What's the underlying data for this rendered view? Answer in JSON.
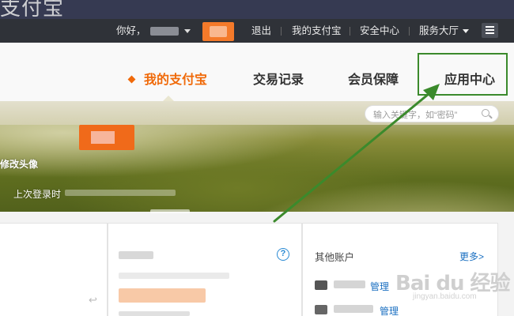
{
  "header": {
    "brand_fragment": "支付宝",
    "greeting": "你好，",
    "logout": "退出",
    "my_alipay": "我的支付宝",
    "security": "安全中心",
    "service_hall": "服务大厅"
  },
  "nav": {
    "items": [
      {
        "label": "我的支付宝",
        "active": true
      },
      {
        "label": "交易记录"
      },
      {
        "label": "会员保障"
      },
      {
        "label": "应用中心"
      }
    ]
  },
  "search": {
    "placeholder": "输入关键字，如“密码”"
  },
  "banner": {
    "edit_avatar": "修改头像",
    "last_login": "上次登录时"
  },
  "panels": {
    "other_accounts": "其他账户",
    "more": "更多>",
    "manage_1": "管理",
    "manage_2": "管理"
  },
  "watermark": {
    "text": "Bai du 经验",
    "url": "jingyan.baidu.com"
  },
  "colors": {
    "accent": "#f06a0a",
    "link": "#1a6fc1",
    "annotation": "#3b8a2c"
  }
}
